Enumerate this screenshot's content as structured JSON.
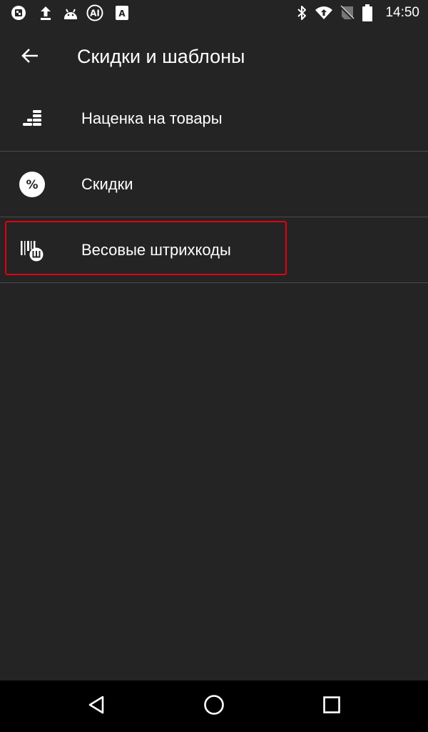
{
  "status_bar": {
    "time": "14:50",
    "left_icons": [
      "notification-app-icon",
      "upload-icon",
      "android-icon",
      "ai-badge-icon",
      "font-a-icon"
    ],
    "right_icons": [
      "bluetooth-icon",
      "wifi-icon",
      "no-sim-icon",
      "battery-icon"
    ]
  },
  "header": {
    "title": "Скидки и шаблоны",
    "back_icon": "arrow-back-icon"
  },
  "menu": {
    "items": [
      {
        "label": "Наценка на товары",
        "icon": "markup-stack-icon"
      },
      {
        "label": "Скидки",
        "icon": "percent-circle-icon"
      },
      {
        "label": "Весовые штрихкоды",
        "icon": "weight-barcode-icon",
        "highlighted": true
      }
    ]
  },
  "highlight_color": "#e3000f",
  "nav_bar": {
    "buttons": [
      "back-triangle-icon",
      "home-circle-icon",
      "recents-square-icon"
    ]
  }
}
